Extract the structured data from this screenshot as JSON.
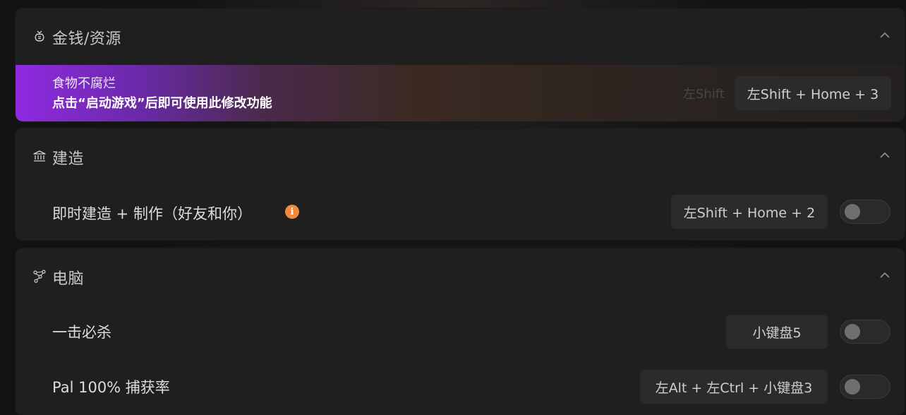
{
  "sections": [
    {
      "title": "金钱/资源",
      "icon": "money-bag-icon",
      "banner": {
        "feature_label": "食物不腐烂",
        "notice": "点击“启动游戏”后即可使用此修改功能",
        "ghost_text": "左Shift",
        "hotkey": "左Shift + Home + 3"
      }
    },
    {
      "title": "建造",
      "icon": "bank-building-icon",
      "items": [
        {
          "label": "即时建造 + 制作（好友和你）",
          "hotkey": "左Shift + Home + 2",
          "enabled": false,
          "has_info": true
        }
      ]
    },
    {
      "title": "电脑",
      "icon": "network-nodes-icon",
      "items": [
        {
          "label": "一击必杀",
          "hotkey": "小键盘5",
          "enabled": false
        },
        {
          "label": "Pal 100% 捕获率",
          "hotkey": "左Alt + 左Ctrl + 小键盘3",
          "enabled": false
        }
      ]
    }
  ],
  "colors": {
    "panel_bg": "#1f1f1f",
    "keybox_bg": "#2b2b2b",
    "banner_start": "#8f2ae0",
    "info_accent": "#f08a3c"
  },
  "info_glyph": "i"
}
